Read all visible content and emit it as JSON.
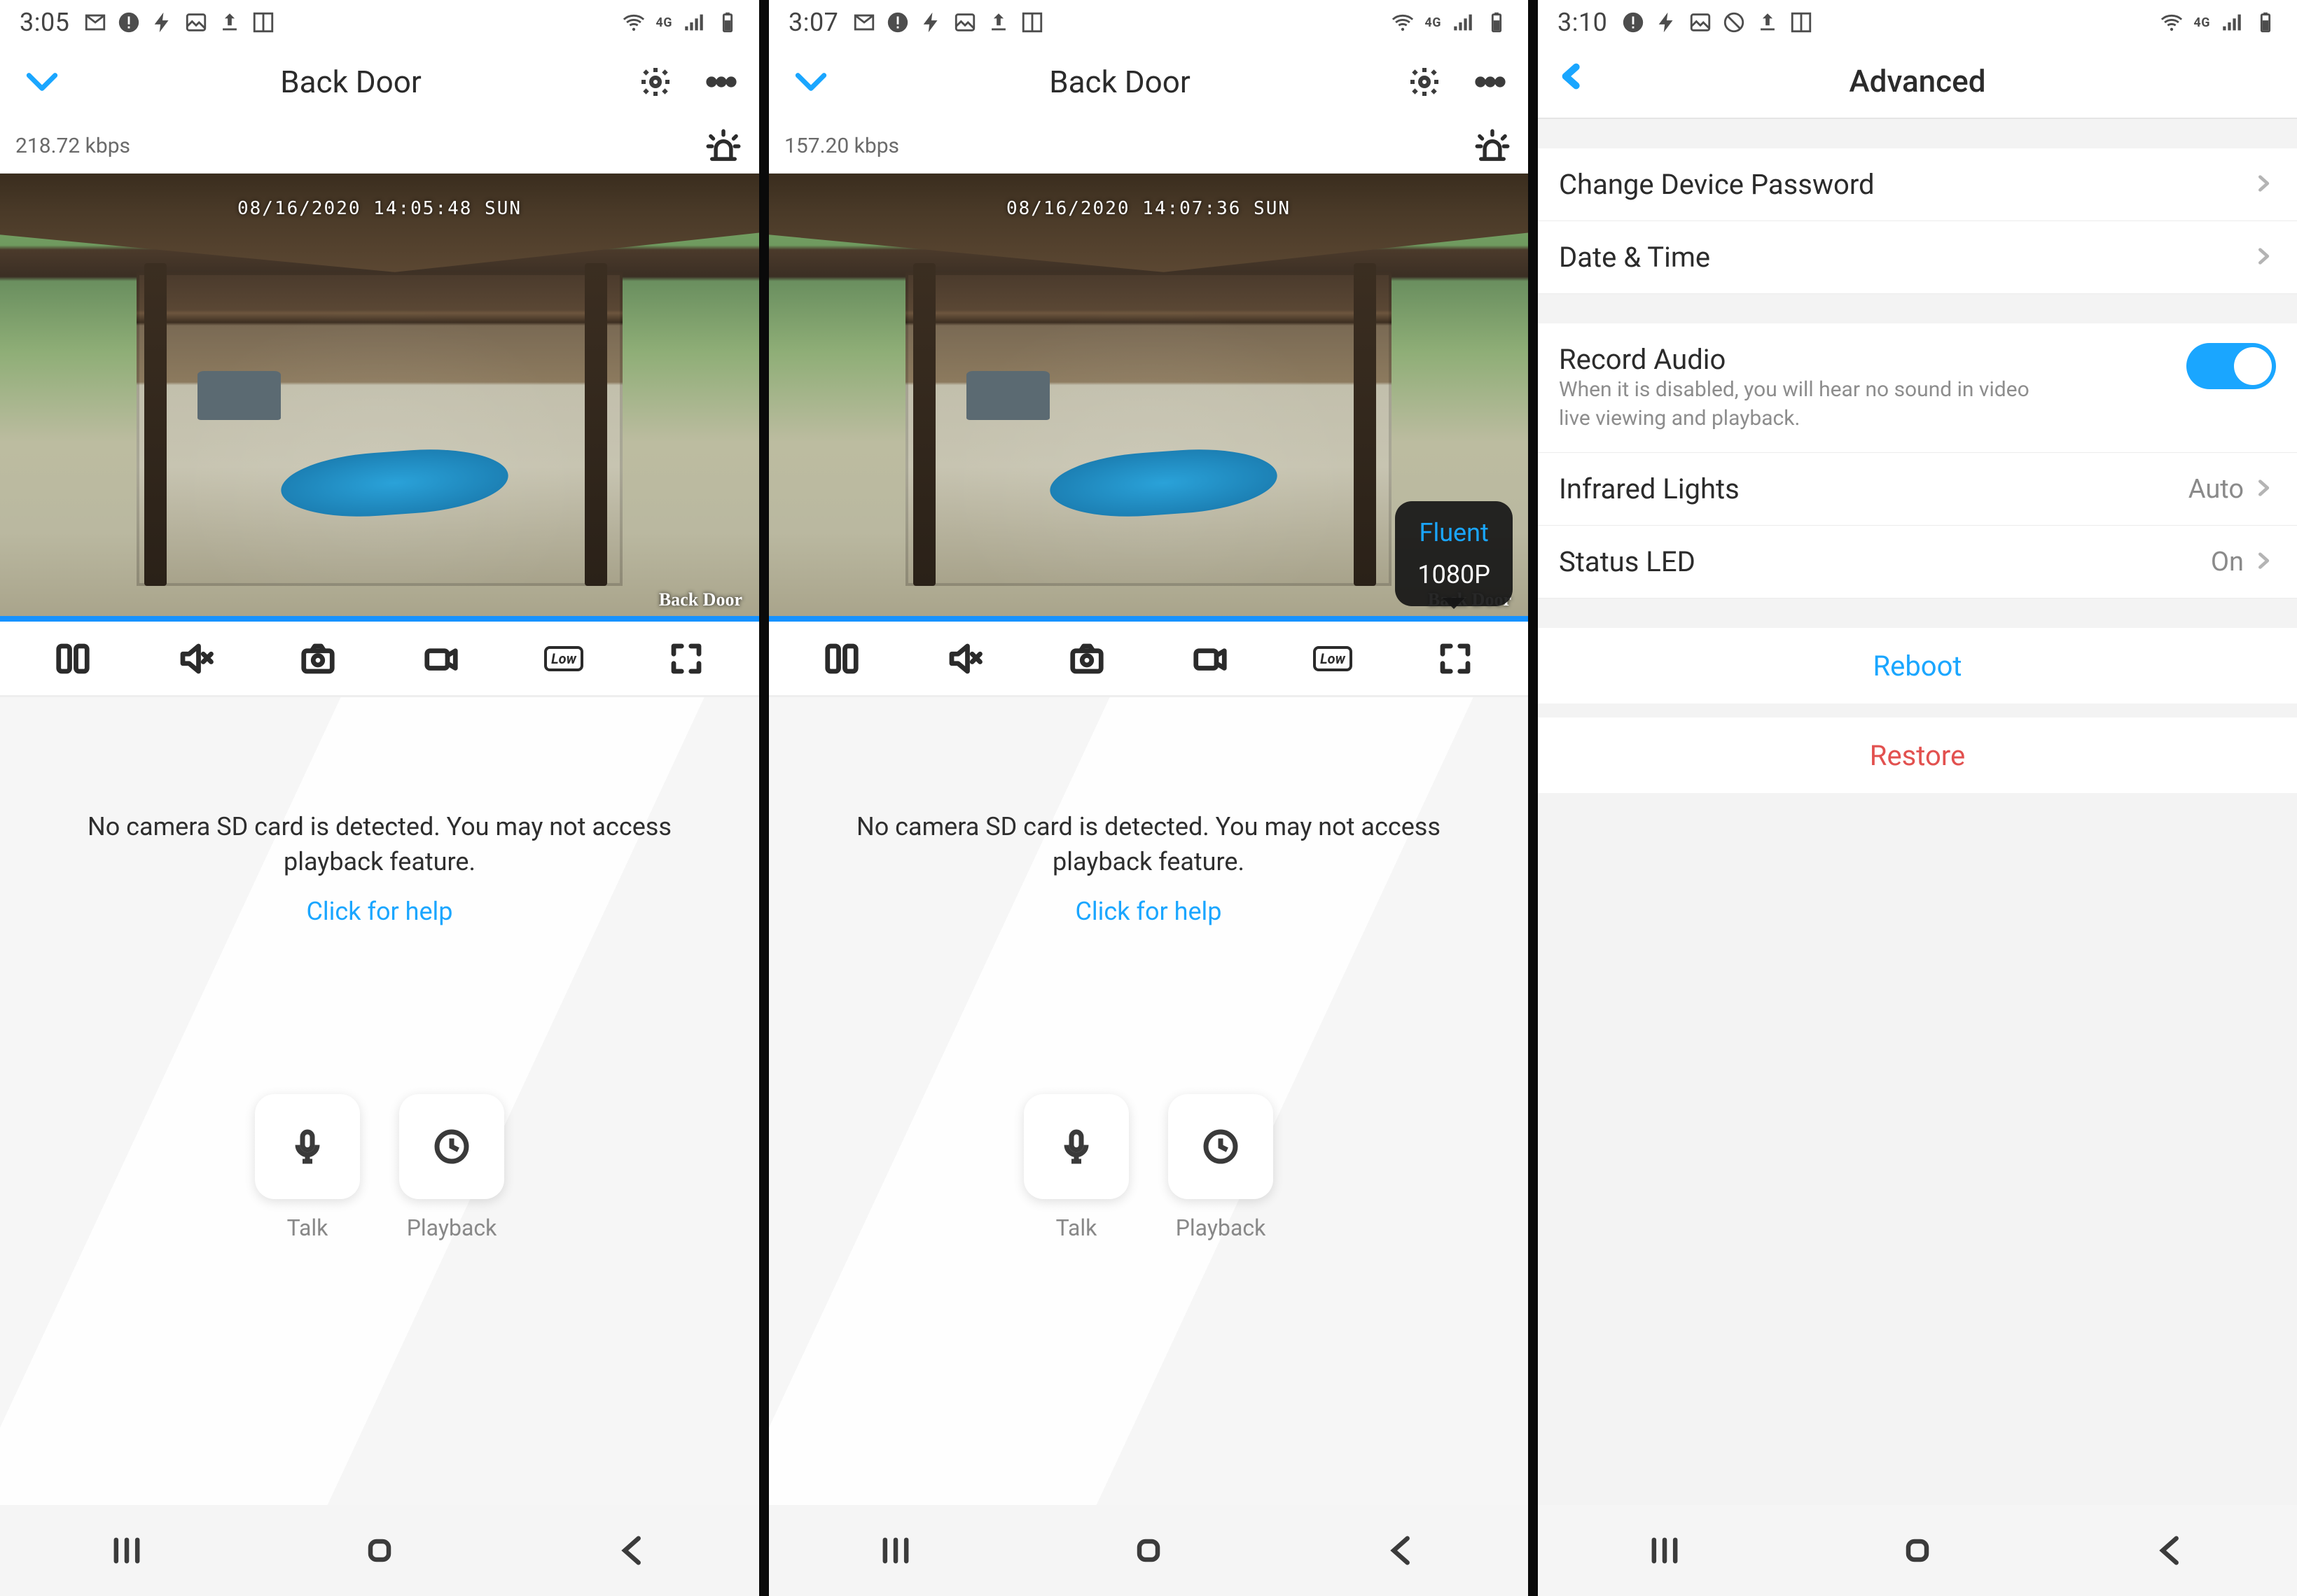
{
  "colors": {
    "accent": "#1aa6ff",
    "danger": "#e2514f"
  },
  "screens": [
    {
      "statusbar": {
        "time": "3:05",
        "signal": "4G",
        "icons": [
          "gmail",
          "alert",
          "bolt",
          "image",
          "upload",
          "book",
          "wifi",
          "bars",
          "battery"
        ]
      },
      "header": {
        "title": "Back Door"
      },
      "bitrate": "218.72 kbps",
      "video": {
        "overlay_timestamp": "08/16/2020 14:05:48 SUN",
        "camera_label": "Back Door",
        "quality_popup": false
      },
      "toolbar": {
        "quality_label": "Low"
      },
      "notice": {
        "line": "No camera SD card is detected. You may not access playback feature.",
        "help_link": "Click for help"
      },
      "actions": {
        "talk": "Talk",
        "playback": "Playback"
      }
    },
    {
      "statusbar": {
        "time": "3:07",
        "signal": "4G",
        "icons": [
          "gmail",
          "alert",
          "bolt",
          "image",
          "upload",
          "book",
          "wifi",
          "bars",
          "battery"
        ]
      },
      "header": {
        "title": "Back Door"
      },
      "bitrate": "157.20 kbps",
      "video": {
        "overlay_timestamp": "08/16/2020 14:07:36 SUN",
        "camera_label": "Back Door",
        "quality_popup": true,
        "quality_options": [
          "Fluent",
          "1080P"
        ],
        "quality_selected": "Fluent"
      },
      "toolbar": {
        "quality_label": "Low"
      },
      "notice": {
        "line": "No camera SD card is detected. You may not access playback feature.",
        "help_link": "Click for help"
      },
      "actions": {
        "talk": "Talk",
        "playback": "Playback"
      }
    },
    {
      "statusbar": {
        "time": "3:10",
        "signal": "4G",
        "icons": [
          "alert",
          "bolt",
          "image",
          "block",
          "upload",
          "book",
          "wifi",
          "bars",
          "battery"
        ]
      },
      "header": {
        "title": "Advanced"
      },
      "settings": {
        "group1": [
          {
            "label": "Change Device Password",
            "value": ""
          },
          {
            "label": "Date & Time",
            "value": ""
          }
        ],
        "record_audio": {
          "label": "Record Audio",
          "desc": "When it is disabled, you will hear no sound in video live viewing and playback.",
          "on": true
        },
        "group2": [
          {
            "label": "Infrared Lights",
            "value": "Auto"
          },
          {
            "label": "Status LED",
            "value": "On"
          }
        ],
        "reboot": "Reboot",
        "restore": "Restore"
      }
    }
  ]
}
